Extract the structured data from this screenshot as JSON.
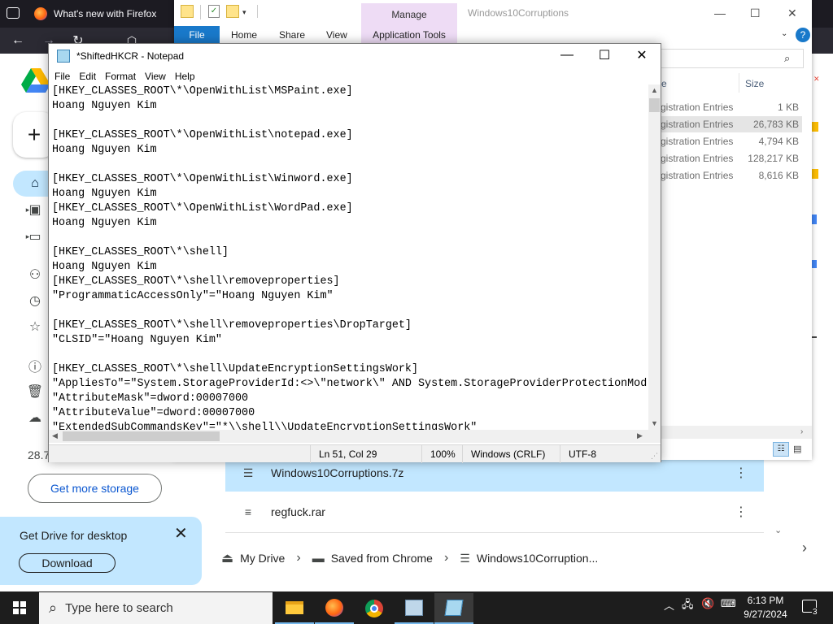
{
  "firefox": {
    "tab_title": "What's new with Firefox"
  },
  "drive": {
    "storage_text": "28.7",
    "get_more_storage": "Get more storage",
    "promo_title": "Get Drive for desktop",
    "download_label": "Download",
    "files": [
      {
        "name": "Windows10Corruptions.7z",
        "selected": true
      },
      {
        "name": "regfuck.rar",
        "selected": false
      }
    ],
    "breadcrumb": [
      "My Drive",
      "Saved from Chrome",
      "Windows10Corruption..."
    ]
  },
  "explorer": {
    "window_title": "Windows10Corruptions",
    "manage_label": "Manage",
    "ribbon_tabs": {
      "file": "File",
      "home": "Home",
      "share": "Share",
      "view": "View",
      "app_tools": "Application Tools"
    },
    "size_header": "Size",
    "name_header": "e",
    "rows": [
      {
        "type": "gistration Entries",
        "size": "1 KB",
        "highlight": false
      },
      {
        "type": "gistration Entries",
        "size": "26,783 KB",
        "highlight": true
      },
      {
        "type": "gistration Entries",
        "size": "4,794 KB",
        "highlight": false
      },
      {
        "type": "gistration Entries",
        "size": "128,217 KB",
        "highlight": false
      },
      {
        "type": "gistration Entries",
        "size": "8,616 KB",
        "highlight": false
      }
    ]
  },
  "notepad": {
    "title": "*ShiftedHKCR - Notepad",
    "menu": {
      "file": "File",
      "edit": "Edit",
      "format": "Format",
      "view": "View",
      "help": "Help"
    },
    "lines": [
      "[HKEY_CLASSES_ROOT\\*\\OpenWithList\\MSPaint.exe]",
      "Hoang Nguyen Kim",
      "",
      "[HKEY_CLASSES_ROOT\\*\\OpenWithList\\notepad.exe]",
      "Hoang Nguyen Kim",
      "",
      "[HKEY_CLASSES_ROOT\\*\\OpenWithList\\Winword.exe]",
      "Hoang Nguyen Kim",
      "[HKEY_CLASSES_ROOT\\*\\OpenWithList\\WordPad.exe]",
      "Hoang Nguyen Kim",
      "",
      "[HKEY_CLASSES_ROOT\\*\\shell]",
      "Hoang Nguyen Kim",
      "[HKEY_CLASSES_ROOT\\*\\shell\\removeproperties]",
      "\"ProgrammaticAccessOnly\"=\"Hoang Nguyen Kim\"",
      "",
      "[HKEY_CLASSES_ROOT\\*\\shell\\removeproperties\\DropTarget]",
      "\"CLSID\"=\"Hoang Nguyen Kim\"",
      "",
      "[HKEY_CLASSES_ROOT\\*\\shell\\UpdateEncryptionSettingsWork]",
      "\"AppliesTo\"=\"System.StorageProviderId:<>\\\"network\\\" AND System.StorageProviderProtectionMod",
      "\"AttributeMask\"=dword:00007000",
      "\"AttributeValue\"=dword:00007000",
      "\"ExtendedSubCommandsKey\"=\"*\\\\shell\\\\UpdateEncryptionSettingsWork\""
    ],
    "status": {
      "position": "Ln 51, Col 29",
      "zoom": "100%",
      "line_endings": "Windows (CRLF)",
      "encoding": "UTF-8"
    }
  },
  "taskbar": {
    "search_placeholder": "Type here to search",
    "time": "6:13 PM",
    "date": "9/27/2024",
    "notification_count": "3",
    "apps": [
      "file-explorer",
      "firefox",
      "chrome",
      "registry-editor",
      "notepad"
    ]
  },
  "colors": {
    "drive_selected": "#c2e7ff",
    "explorer_manage": "#eedcf5",
    "explorer_file_tab": "#1979ca",
    "taskbar": "#1d1d1d"
  }
}
